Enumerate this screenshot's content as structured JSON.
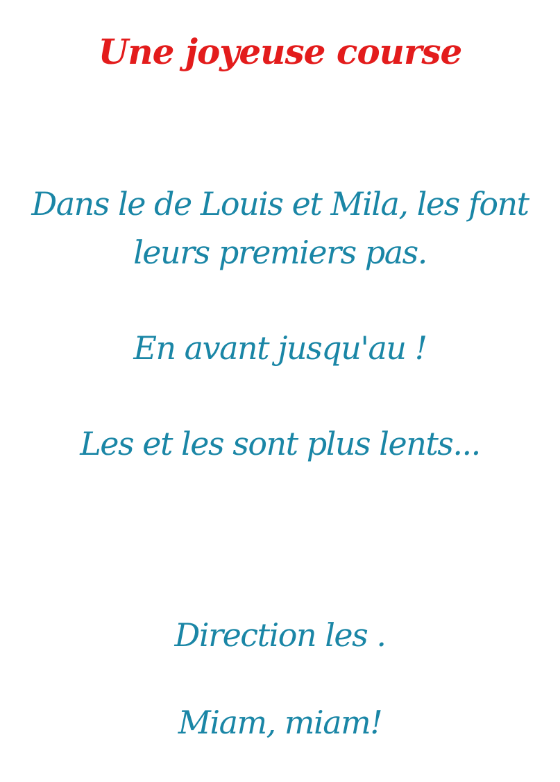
{
  "document": {
    "title": "Une joyeuse course",
    "lines": [
      "Dans le  de Louis et Mila, les  font",
      "leurs premiers pas.",
      "En avant jusqu'au !",
      "Les  et les  sont plus lents...",
      "Direction les .",
      "Miam, miam!"
    ]
  },
  "colors": {
    "title": "#e31c1c",
    "text": "#1a86a6",
    "background": "#ffffff"
  }
}
